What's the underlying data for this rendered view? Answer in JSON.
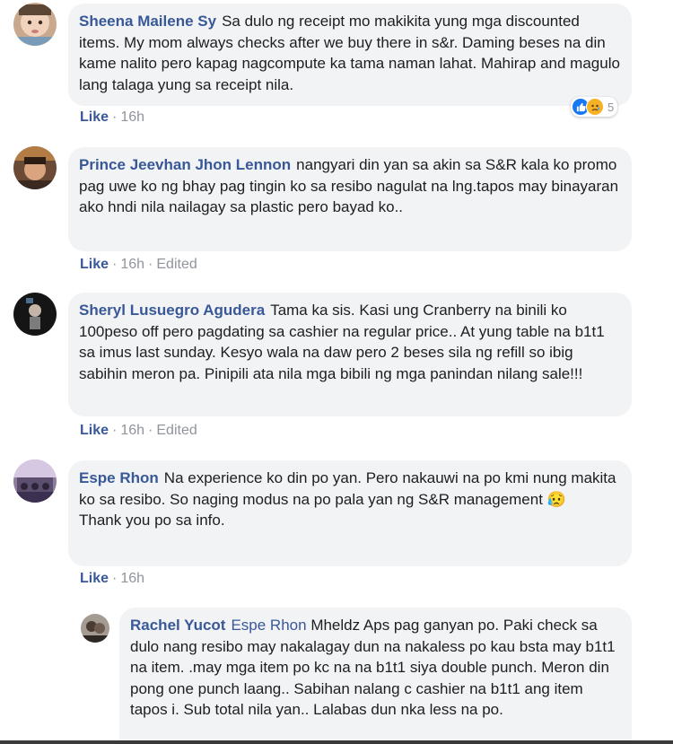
{
  "comments": [
    {
      "author": "Sheena Mailene Sy",
      "text": "Sa dulo ng receipt mo makikita yung mga discounted items. My mom always checks after we buy there in s&r. Daming beses na din kame nalito pero kapag nagcompute ka tama naman lahat. Mahirap and magulo lang talaga yung sa receipt nila.",
      "like": "Like",
      "time": "16h",
      "reaction_count": "5",
      "reaction_icons": [
        "like-icon",
        "sad-icon"
      ]
    },
    {
      "author": "Prince Jeevhan Jhon Lennon",
      "text": "nangyari din yan sa akin sa S&R kala ko promo pag uwe ko ng bhay pag tingin ko sa resibo nagulat na lng.tapos may binayaran ako hndi nila nailagay sa plastic pero bayad ko..",
      "like": "Like",
      "time": "16h",
      "edited": "Edited"
    },
    {
      "author": "Sheryl Lusuegro Agudera",
      "text": "Tama ka sis. Kasi ung Cranberry na binili ko 100peso off pero pagdating sa cashier na regular price.. At yung table na b1t1 sa imus last sunday. Kesyo wala na daw pero 2 beses sila ng refill so ibig sabihin meron pa. Pinipili ata nila mga bibili ng mga panindan nilang sale!!!",
      "like": "Like",
      "time": "16h",
      "edited": "Edited"
    },
    {
      "author": "Espe Rhon",
      "text": "Na experience ko din po yan. Pero nakauwi na po kmi nung makita ko sa resibo. So naging modus na po pala yan ng S&R management",
      "emoji": "😥",
      "text2": "Thank you po sa info.",
      "like": "Like",
      "time": "16h"
    },
    {
      "author": "Rachel Yucot",
      "mention": "Espe Rhon",
      "text": "Mheldz Aps pag ganyan po. Paki check sa dulo nang resibo may nakalagay dun na nakaless po kau bsta may b1t1 na item. .may mga item po kc na na b1t1 siya double punch. Meron din pong one punch laang.. Sabihan nalang c cashier na b1t1 ang item tapos i. Sub total nila yan.. Lalabas dun nka less na po."
    }
  ],
  "colors": {
    "link": "#385898",
    "bubble": "#f2f3f5",
    "meta": "#90949c"
  }
}
